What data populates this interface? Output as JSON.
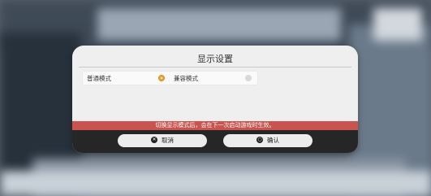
{
  "dialog": {
    "title": "显示设置",
    "options": [
      {
        "label": "普通模式",
        "selected": true
      },
      {
        "label": "兼容模式",
        "selected": false
      }
    ],
    "notice": "切换显示模式后，会在下一次启动游戏时生效。",
    "cancel_label": "取消",
    "confirm_label": "确认",
    "cancel_icon": "circle-x-icon",
    "confirm_icon": "circle-o-icon"
  },
  "colors": {
    "accent": "#f4a23c",
    "notice_bg": "#c9534e",
    "footer_bg": "#262626"
  }
}
